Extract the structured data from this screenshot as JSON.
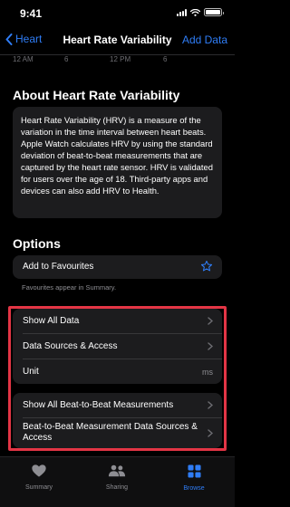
{
  "status_bar": {
    "time": "9:41"
  },
  "nav": {
    "back_label": "Heart",
    "title": "Heart Rate Variability",
    "action_label": "Add Data"
  },
  "chart_axis": {
    "labels": [
      "12 AM",
      "6",
      "12 PM",
      "6"
    ]
  },
  "about": {
    "heading": "About Heart Rate Variability",
    "body": "Heart Rate Variability (HRV) is a measure of the variation in the time interval between heart beats. Apple Watch calculates HRV by using the standard deviation of beat-to-beat measurements that are captured by the heart rate sensor. HRV is validated for users over the age of 18. Third-party apps and devices can also add HRV to Health."
  },
  "options": {
    "heading": "Options",
    "favourites_label": "Add to Favourites",
    "favourites_note": "Favourites appear in Summary.",
    "rows": [
      {
        "label": "Show All Data"
      },
      {
        "label": "Data Sources & Access"
      },
      {
        "label": "Unit",
        "value": "ms"
      }
    ],
    "rows2": [
      {
        "label": "Show All Beat-to-Beat Measurements"
      },
      {
        "label": "Beat-to-Beat Measurement Data Sources & Access"
      }
    ]
  },
  "tab_bar": {
    "tabs": [
      {
        "label": "Summary",
        "icon": "heart-icon"
      },
      {
        "label": "Sharing",
        "icon": "people-icon"
      },
      {
        "label": "Browse",
        "icon": "grid-icon"
      }
    ],
    "active": "Browse"
  },
  "colors": {
    "accent": "#2f7df6",
    "highlight": "#e33545",
    "card": "#1c1c1e"
  }
}
